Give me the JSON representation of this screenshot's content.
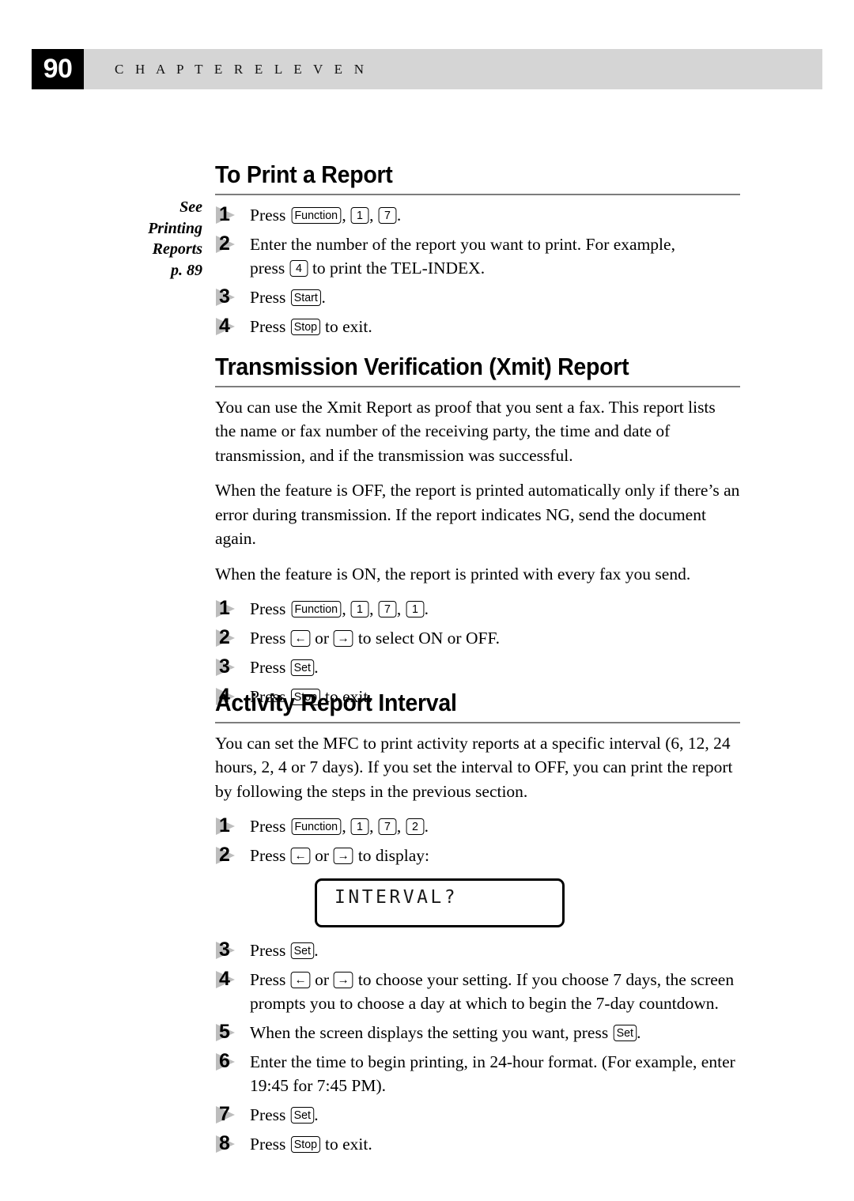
{
  "header": {
    "page_number": "90",
    "chapter_label": "C H A P T E R   E L E V E N"
  },
  "margin_note": {
    "line1": "See",
    "line2": "Printing",
    "line3": "Reports",
    "line4": "p. 89"
  },
  "sections": [
    {
      "id": "to-print-a-report",
      "heading": "To Print a Report",
      "steps": [
        {
          "number": "1",
          "parts": [
            {
              "t": "text",
              "v": "Press "
            },
            {
              "t": "key",
              "v": "Function"
            },
            {
              "t": "text",
              "v": ", "
            },
            {
              "t": "key",
              "v": "1"
            },
            {
              "t": "text",
              "v": ", "
            },
            {
              "t": "key",
              "v": "7"
            },
            {
              "t": "text",
              "v": "."
            }
          ]
        },
        {
          "number": "2",
          "parts": [
            {
              "t": "text",
              "v": "Enter the number of the report you want to print.  For example,"
            },
            {
              "t": "br"
            },
            {
              "t": "text",
              "v": "press "
            },
            {
              "t": "key",
              "v": "4"
            },
            {
              "t": "text",
              "v": " to print the TEL-INDEX."
            }
          ]
        },
        {
          "number": "3",
          "parts": [
            {
              "t": "text",
              "v": "Press "
            },
            {
              "t": "key",
              "v": "Start"
            },
            {
              "t": "text",
              "v": "."
            }
          ]
        },
        {
          "number": "4",
          "parts": [
            {
              "t": "text",
              "v": "Press "
            },
            {
              "t": "key",
              "v": "Stop"
            },
            {
              "t": "text",
              "v": " to exit."
            }
          ]
        }
      ]
    },
    {
      "id": "transmission-verification-xmit-report",
      "heading": "Transmission Verification (Xmit) Report",
      "paragraphs": [
        "You can use the Xmit Report as proof that you sent a fax.  This report lists the name or fax number of the receiving party, the time and date of transmission, and if the transmission was successful.",
        "When the feature is OFF, the report is printed automatically only if there’s an error during transmission.  If the report indicates NG, send the document again.",
        "When the feature is ON, the report is printed with every fax you send."
      ],
      "steps": [
        {
          "number": "1",
          "parts": [
            {
              "t": "text",
              "v": "Press "
            },
            {
              "t": "key",
              "v": "Function"
            },
            {
              "t": "text",
              "v": ", "
            },
            {
              "t": "key",
              "v": "1"
            },
            {
              "t": "text",
              "v": ", "
            },
            {
              "t": "key",
              "v": "7"
            },
            {
              "t": "text",
              "v": ", "
            },
            {
              "t": "key",
              "v": "1"
            },
            {
              "t": "text",
              "v": "."
            }
          ]
        },
        {
          "number": "2",
          "parts": [
            {
              "t": "text",
              "v": "Press "
            },
            {
              "t": "arrow",
              "v": "←"
            },
            {
              "t": "text",
              "v": " or "
            },
            {
              "t": "arrow",
              "v": "→"
            },
            {
              "t": "text",
              "v": " to select ON or OFF."
            }
          ]
        },
        {
          "number": "3",
          "parts": [
            {
              "t": "text",
              "v": "Press "
            },
            {
              "t": "key",
              "v": "Set"
            },
            {
              "t": "text",
              "v": "."
            }
          ]
        },
        {
          "number": "4",
          "parts": [
            {
              "t": "text",
              "v": "Press "
            },
            {
              "t": "key",
              "v": "Stop"
            },
            {
              "t": "text",
              "v": " to exit."
            }
          ]
        }
      ]
    },
    {
      "id": "activity-report-interval",
      "heading": "Activity Report Interval",
      "paragraphs": [
        "You can set the MFC to print activity reports at a specific interval (6, 12, 24 hours, 2, 4 or 7 days).  If you set the interval to OFF, you can print the report by following the steps in the previous section."
      ],
      "steps_before_lcd": [
        {
          "number": "1",
          "parts": [
            {
              "t": "text",
              "v": "Press "
            },
            {
              "t": "key",
              "v": "Function"
            },
            {
              "t": "text",
              "v": ", "
            },
            {
              "t": "key",
              "v": "1"
            },
            {
              "t": "text",
              "v": ", "
            },
            {
              "t": "key",
              "v": "7"
            },
            {
              "t": "text",
              "v": ", "
            },
            {
              "t": "key",
              "v": "2"
            },
            {
              "t": "text",
              "v": "."
            }
          ]
        },
        {
          "number": "2",
          "parts": [
            {
              "t": "text",
              "v": "Press "
            },
            {
              "t": "arrow",
              "v": "←"
            },
            {
              "t": "text",
              "v": " or "
            },
            {
              "t": "arrow",
              "v": "→"
            },
            {
              "t": "text",
              "v": " to display:"
            }
          ]
        }
      ],
      "lcd": {
        "text": "INTERVAL?"
      },
      "steps_after_lcd": [
        {
          "number": "3",
          "parts": [
            {
              "t": "text",
              "v": "Press "
            },
            {
              "t": "key",
              "v": "Set"
            },
            {
              "t": "text",
              "v": "."
            }
          ]
        },
        {
          "number": "4",
          "parts": [
            {
              "t": "text",
              "v": "Press "
            },
            {
              "t": "arrow",
              "v": "←"
            },
            {
              "t": "text",
              "v": " or "
            },
            {
              "t": "arrow",
              "v": "→"
            },
            {
              "t": "text",
              "v": " to choose your setting.  If you choose 7 days, the screen"
            },
            {
              "t": "br"
            },
            {
              "t": "text",
              "v": "prompts you to choose a day at which to begin the 7-day countdown."
            }
          ]
        },
        {
          "number": "5",
          "parts": [
            {
              "t": "text",
              "v": "When the screen displays the setting you want, press "
            },
            {
              "t": "key",
              "v": "Set"
            },
            {
              "t": "text",
              "v": "."
            }
          ]
        },
        {
          "number": "6",
          "parts": [
            {
              "t": "text",
              "v": "Enter the time to begin printing, in 24-hour format.  (For example, enter"
            },
            {
              "t": "br"
            },
            {
              "t": "text",
              "v": "19:45 for 7:45 PM)."
            }
          ]
        },
        {
          "number": "7",
          "parts": [
            {
              "t": "text",
              "v": "Press "
            },
            {
              "t": "key",
              "v": "Set"
            },
            {
              "t": "text",
              "v": "."
            }
          ]
        },
        {
          "number": "8",
          "parts": [
            {
              "t": "text",
              "v": "Press "
            },
            {
              "t": "key",
              "v": "Stop"
            },
            {
              "t": "text",
              "v": " to exit."
            }
          ]
        }
      ]
    }
  ]
}
